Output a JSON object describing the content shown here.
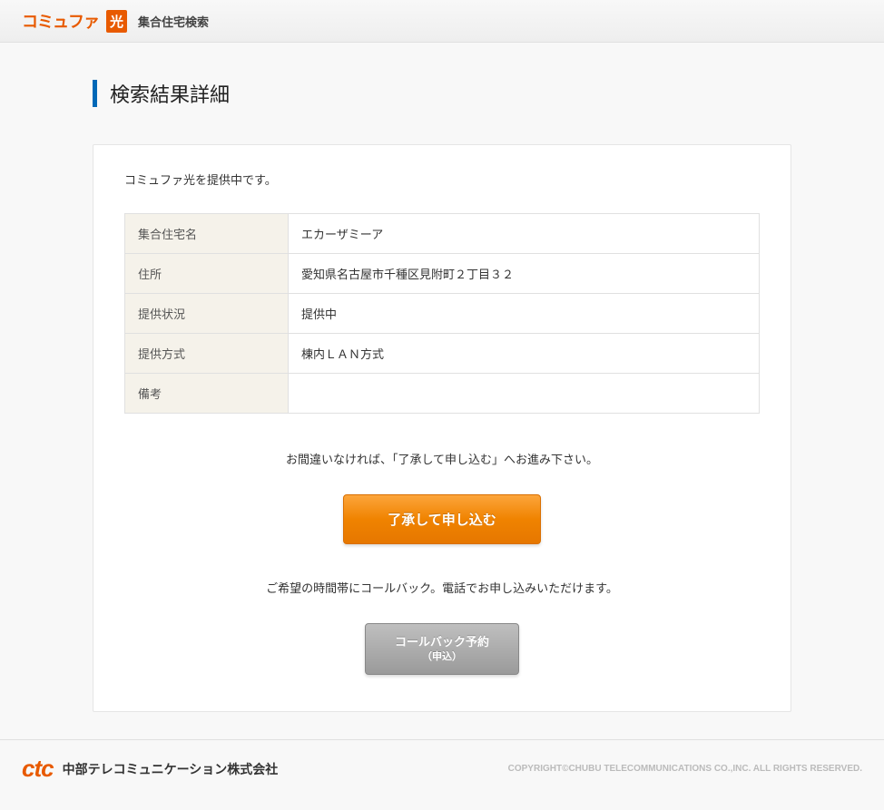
{
  "header": {
    "logo_text": "コミュファ",
    "logo_hikari": "光",
    "subtitle": "集合住宅検索"
  },
  "page_title": "検索結果詳細",
  "intro_text": "コミュファ光を提供中です。",
  "table": {
    "rows": [
      {
        "label": "集合住宅名",
        "value": "エカーザミーア"
      },
      {
        "label": "住所",
        "value": "愛知県名古屋市千種区見附町２丁目３２"
      },
      {
        "label": "提供状況",
        "value": "提供中"
      },
      {
        "label": "提供方式",
        "value": "棟内ＬＡＮ方式"
      },
      {
        "label": "備考",
        "value": ""
      }
    ]
  },
  "instruction1": "お間違いなければ、「了承して申し込む」へお進み下さい。",
  "primary_button": "了承して申し込む",
  "instruction2": "ご希望の時間帯にコールバック。電話でお申し込みいただけます。",
  "secondary_button_main": "コールバック予約",
  "secondary_button_sub": "（申込）",
  "footer": {
    "logo": "ctc",
    "company": "中部テレコミュニケーション株式会社",
    "copyright": "COPYRIGHT©CHUBU TELECOMMUNICATIONS CO.,INC. ALL RIGHTS RESERVED."
  }
}
